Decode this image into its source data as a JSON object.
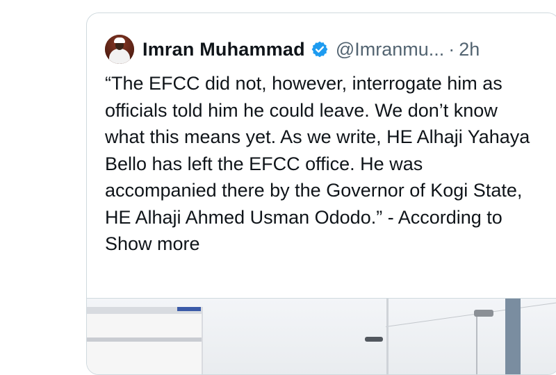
{
  "tweet": {
    "author_name": "Imran Muhammad",
    "handle": "@Imranmu...",
    "separator": "·",
    "time": "2h",
    "text": "“The EFCC did not, however, interrogate him as officials told him he could leave. We don’t know what this means yet. As we write, HE Alhaji Yahaya Bello has left the EFCC office. He was accompanied there by the Governor of Kogi State, HE Alhaji Ahmed Usman Ododo.” - According to",
    "show_more": "Show more"
  },
  "icons": {
    "avatar": "profile-avatar",
    "verified": "verified-badge-icon"
  },
  "colors": {
    "verified_blue": "#1d9bf0",
    "handle_gray": "#536471",
    "border": "#cfd9de"
  }
}
